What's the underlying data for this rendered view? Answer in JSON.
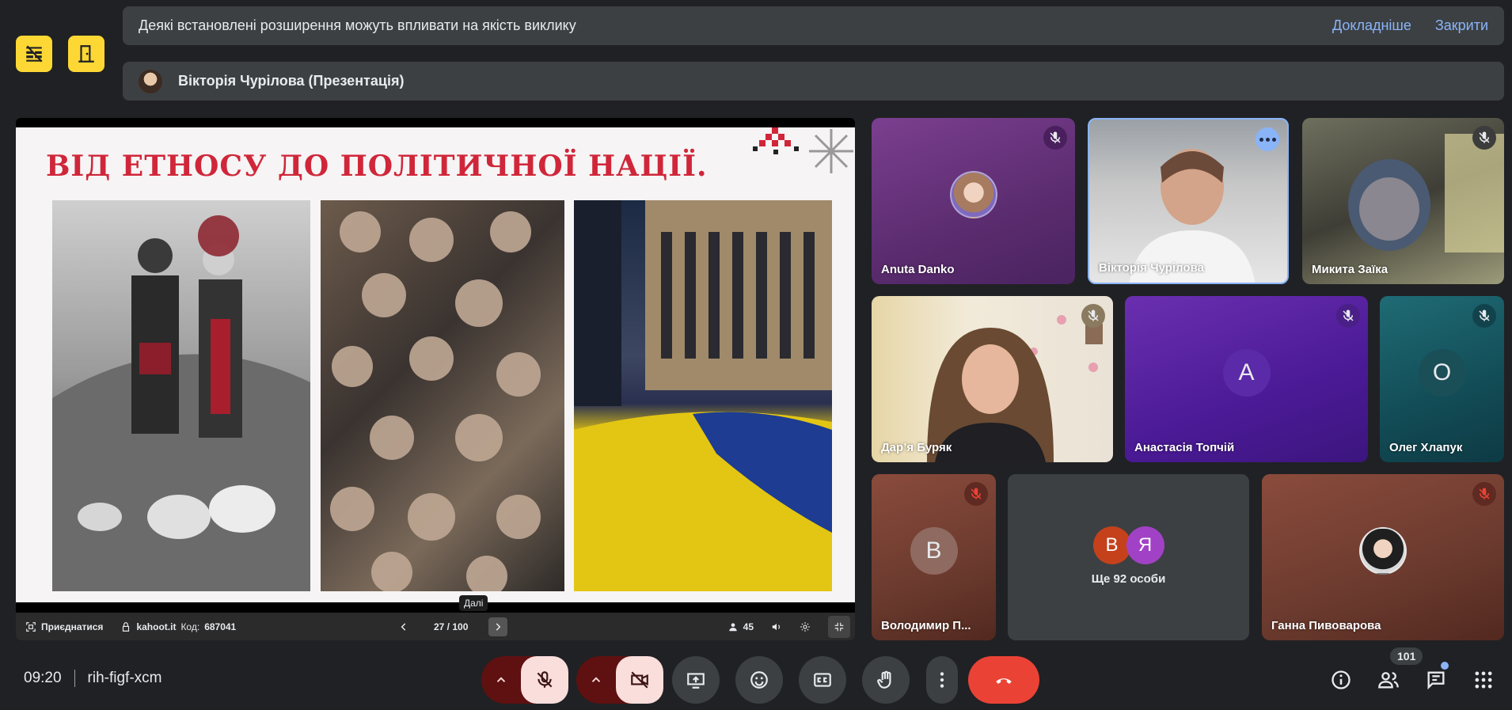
{
  "banner": {
    "message": "Деякі встановлені розширення можуть впливати на якість виклику",
    "details_label": "Докладніше",
    "close_label": "Закрити"
  },
  "presenter": {
    "label": "Вікторія Чурілова (Презентація)"
  },
  "slide": {
    "title": "ВІД ЕТНОСУ ДО ПОЛІТИЧНОЇ НАЦІЇ."
  },
  "pres_toolbar": {
    "join_label": "Приєднатися",
    "site": "kahoot.it",
    "code_label": "Код:",
    "code": "687041",
    "page": "27 / 100",
    "participants": "45",
    "next_tooltip": "Далі"
  },
  "tiles": [
    {
      "name": "Anuta Danko",
      "type": "photo-avatar",
      "muted": true
    },
    {
      "name": "Вікторія Чурілова",
      "type": "video",
      "muted": false,
      "active": true
    },
    {
      "name": "Микита Заїка",
      "type": "video",
      "muted": true
    },
    {
      "name": "Дар’я Буряк",
      "type": "video",
      "muted": true
    },
    {
      "name": "Анастасія Топчій",
      "type": "letter",
      "letter": "А",
      "muted": true
    },
    {
      "name": "Олег Хлапук",
      "type": "letter",
      "letter": "О",
      "muted": true
    },
    {
      "name": "Володимир П...",
      "type": "letter",
      "letter": "В",
      "muted": true
    },
    {
      "name": "Ще 92 особи",
      "type": "more",
      "letters": [
        "В",
        "Я"
      ]
    },
    {
      "name": "Ганна Пивоварова",
      "type": "photo-avatar",
      "muted": true
    }
  ],
  "bottom": {
    "time": "09:20",
    "meeting_code": "rih-figf-xcm",
    "people_count": "101"
  },
  "colors": {
    "accent": "#8ab4f8",
    "end_call": "#ea4335",
    "side_button": "#fdd835",
    "slide_title": "#d0263a"
  }
}
